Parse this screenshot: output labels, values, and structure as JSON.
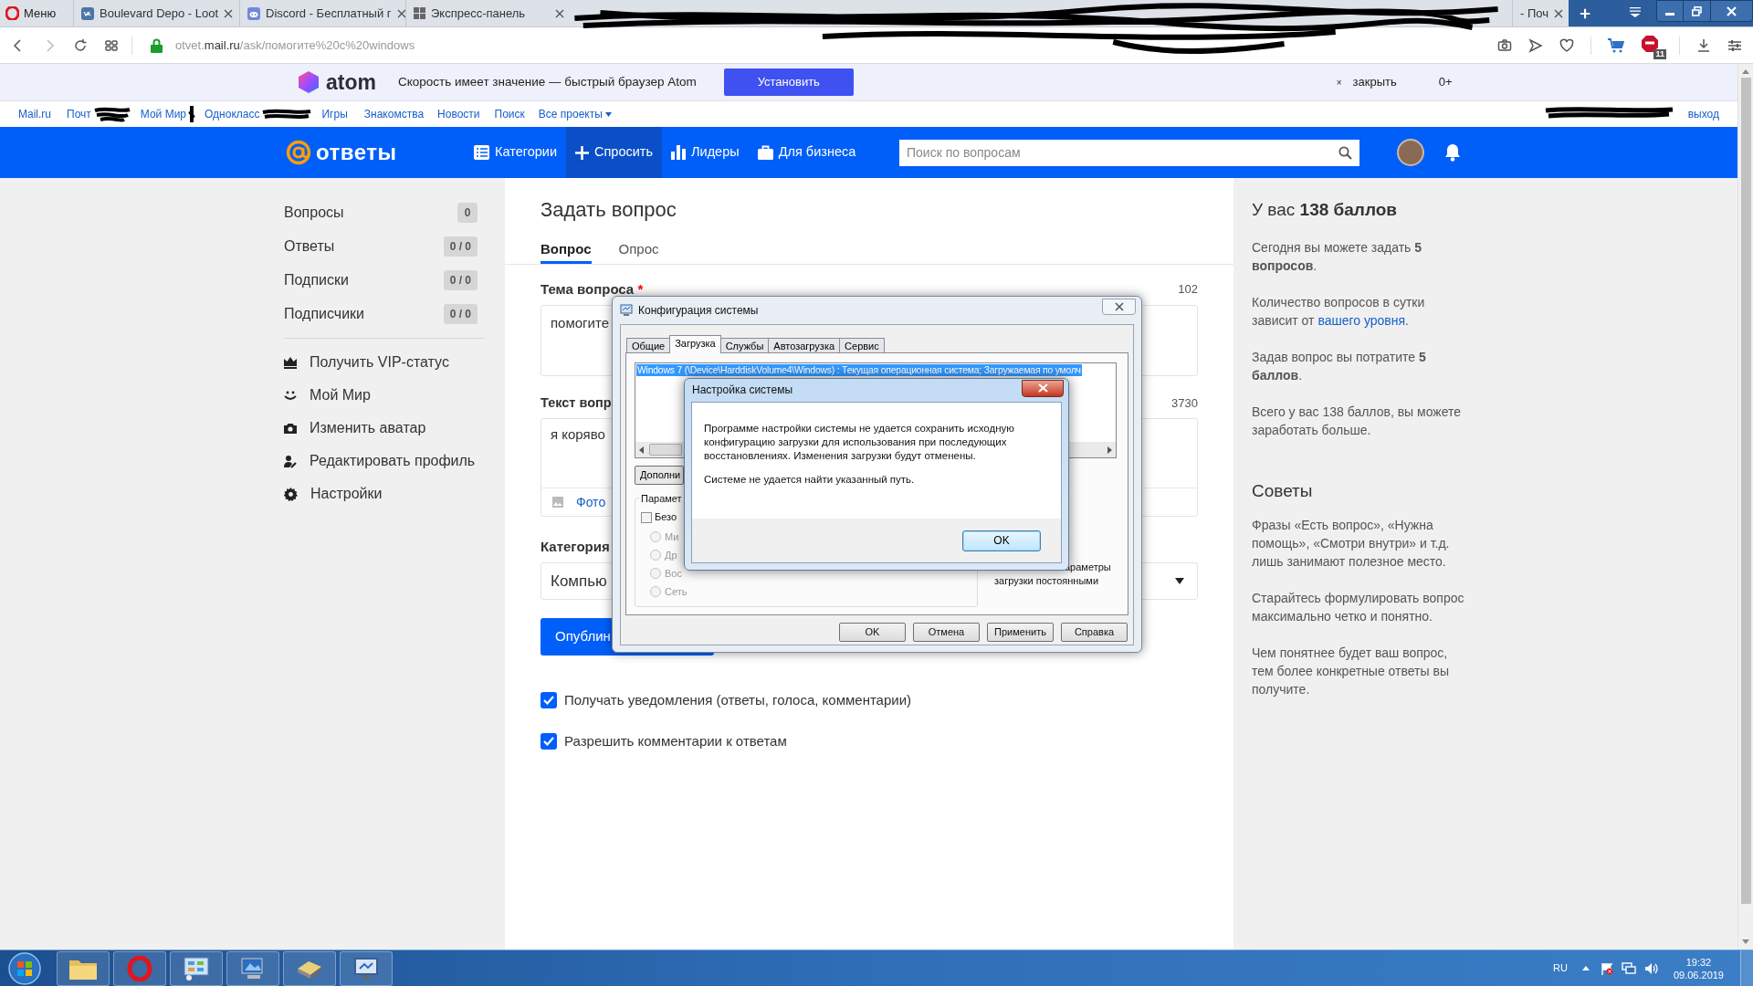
{
  "browser": {
    "menu": "Меню",
    "tabs": [
      {
        "title": "Boulevard Depo - Loot",
        "selected": false
      },
      {
        "title": "Discord - Бесплатный г",
        "selected": false
      },
      {
        "title": "Экспресс-панель",
        "selected": false
      },
      {
        "title": "- Поч",
        "selected": false
      }
    ],
    "url": {
      "prefix": "otvet.",
      "host": "mail.ru",
      "path": "/ask/помогите%20c%20windows"
    },
    "adblock_count": "11"
  },
  "banner": {
    "brand": "atom",
    "text": "Скорость имеет значение — быстрый браузер Atom",
    "button": "Установить",
    "close_mark": "×",
    "close": "закрыть",
    "age": "0+"
  },
  "portal": {
    "links": [
      "Mail.ru",
      "Почт",
      "Мой Мир",
      "Однокласс",
      "Игры",
      "Знакомства",
      "Новости",
      "Поиск",
      "Все проекты"
    ],
    "logout": "выход"
  },
  "header": {
    "logo": "ответы",
    "nav": [
      {
        "label": "Категории",
        "selected": false
      },
      {
        "label": "Спросить",
        "selected": true
      },
      {
        "label": "Лидеры",
        "selected": false
      },
      {
        "label": "Для бизнеса",
        "selected": false
      }
    ],
    "search_placeholder": "Поиск по вопросам"
  },
  "sidebar": {
    "counters": [
      {
        "label": "Вопросы",
        "count": "0"
      },
      {
        "label": "Ответы",
        "count": "0 / 0"
      },
      {
        "label": "Подписки",
        "count": "0 / 0"
      },
      {
        "label": "Подписчики",
        "count": "0 / 0"
      }
    ],
    "menu": [
      "Получить VIP-статус",
      "Мой Мир",
      "Изменить аватар",
      "Редактировать профиль",
      "Настройки"
    ]
  },
  "form": {
    "title": "Задать вопрос",
    "tabs": [
      {
        "label": "Вопрос",
        "selected": true
      },
      {
        "label": "Опрос",
        "selected": false
      }
    ],
    "subject": {
      "label": "Тема вопроса",
      "required_mark": "*",
      "counter": "102",
      "value": "помогите"
    },
    "body": {
      "label": "Текст вопр",
      "counter": "3730",
      "value": "я коряво",
      "photo": "Фото"
    },
    "category": {
      "label": "Категория",
      "value": "Компью"
    },
    "publish": "Опублин",
    "options": [
      {
        "label": "Получать уведомления (ответы, голоса, комментарии)",
        "checked": true
      },
      {
        "label": "Разрешить комментарии к ответам",
        "checked": true
      }
    ]
  },
  "info": {
    "heading": "У вас **138 баллов**",
    "paragraphs": [
      {
        "text": "Сегодня вы можете задать **5 вопросов**."
      },
      {
        "text": "Количество вопросов в сутки зависит от",
        "link": "вашего уровня",
        "after": "."
      },
      {
        "text": "Задав вопрос вы потратите **5 баллов**."
      },
      {
        "text": "Всего у вас 138 баллов, вы можете заработать больше."
      }
    ]
  },
  "tips": {
    "heading": "Советы",
    "paragraphs": [
      "Фразы «Есть вопрос», «Нужна помощь», «Смотри внутри» и т.д. лишь занимают полезное место.",
      "Старайтесь формулировать вопрос максимально четко и понятно.",
      "Чем понятнее будет ваш вопрос, тем более конкретные ответы вы получите."
    ]
  },
  "sysconfig": {
    "title": "Конфигурация системы",
    "tabs": [
      {
        "label": "Общие",
        "selected": false
      },
      {
        "label": "Загрузка",
        "selected": true
      },
      {
        "label": "Службы",
        "selected": false
      },
      {
        "label": "Автозагрузка",
        "selected": false
      },
      {
        "label": "Сервис",
        "selected": false
      }
    ],
    "entries": [
      {
        "text": "Windows 7 (\\Device\\HarddiskVolume4\\Windows) : Текущая операционная система; Загружаемая по умолч",
        "selected": true
      }
    ],
    "advanced_button": "Дополни",
    "options_group": "Парамет",
    "safe_boot": {
      "label": "Безо",
      "checked": false
    },
    "radios": [
      {
        "label": "Ми",
        "selected": false,
        "disabled": true
      },
      {
        "label": "Др",
        "selected": false,
        "disabled": true
      },
      {
        "label": "Вос",
        "selected": false,
        "disabled": true
      },
      {
        "label": "Сеть",
        "selected": false,
        "disabled": true
      }
    ],
    "permanent_lines": [
      "араметры",
      "загрузки постоянными"
    ],
    "buttons": [
      "OK",
      "Отмена",
      "Применить",
      "Справка"
    ]
  },
  "message": {
    "title": "Настройка системы",
    "paragraphs": [
      "Программе настройки системы не удается сохранить исходную конфигурацию загрузки для использования при последующих восстановлениях. Изменения загрузки будут отменены.",
      "Системе не удается найти указанный путь."
    ],
    "button": "OK"
  },
  "taskbar": {
    "language": "RU",
    "time": "19:32",
    "date": "09.06.2019"
  }
}
